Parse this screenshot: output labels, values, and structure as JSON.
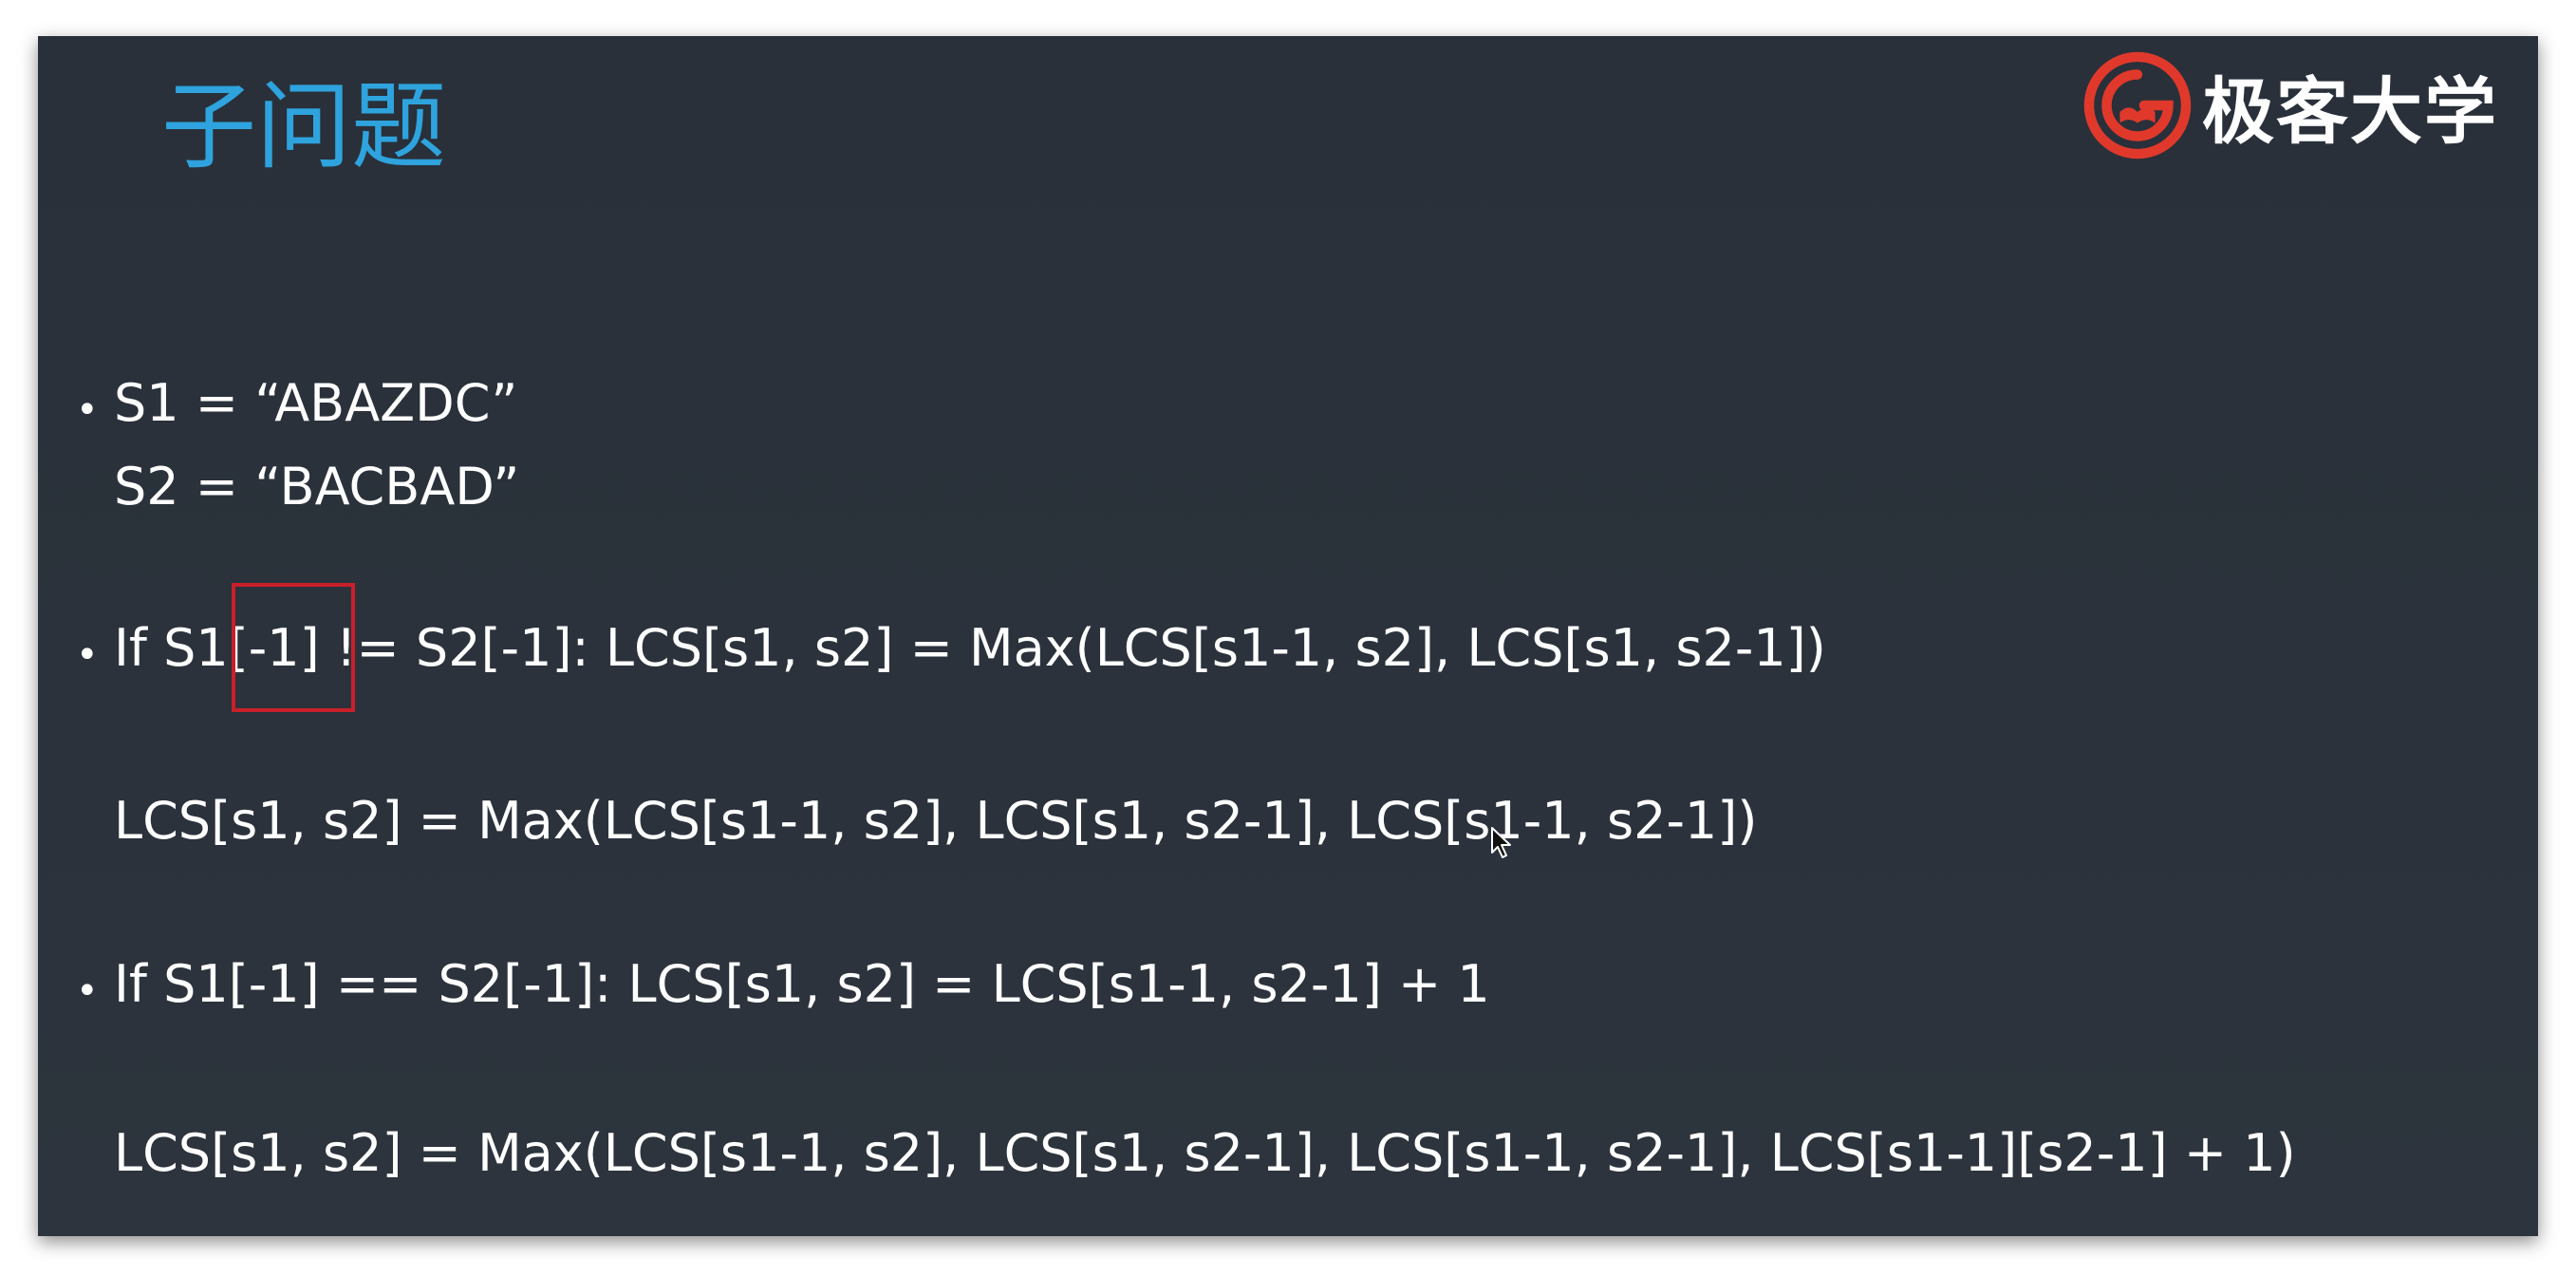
{
  "slide": {
    "title": "子问题",
    "brand": {
      "name": "极客大学",
      "logo_icon": "geek-university-logo-icon",
      "logo_color": "#e0392c"
    },
    "bullets": [
      {
        "lines": [
          "S1 = “ABAZDC”",
          "S2 = “BACBAD”"
        ]
      },
      {
        "lines": [
          "If S1[-1] != S2[-1]: LCS[s1, s2] = Max(LCS[s1-1, s2], LCS[s1, s2-1])",
          "LCS[s1, s2] = Max(LCS[s1-1, s2], LCS[s1, s2-1], LCS[s1-1, s2-1])"
        ]
      },
      {
        "lines": [
          "If S1[-1] == S2[-1]: LCS[s1, s2] = LCS[s1-1, s2-1] + 1",
          "LCS[s1, s2] = Max(LCS[s1-1, s2], LCS[s1, s2-1], LCS[s1-1, s2-1], LCS[s1-1][s2-1] + 1)"
        ]
      }
    ],
    "bullet_glyph": "•",
    "highlight_color": "#c8202a",
    "title_color": "#2ea3dd"
  }
}
